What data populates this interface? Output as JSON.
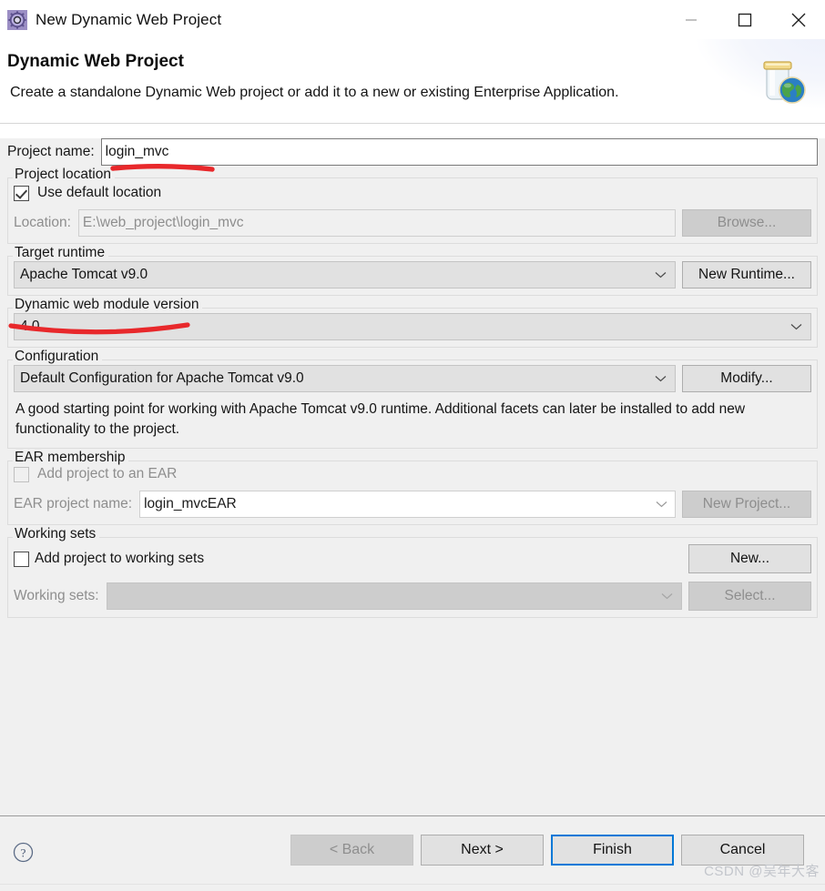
{
  "window": {
    "title": "New Dynamic Web Project",
    "icon": "gear-icon",
    "minimize": "—",
    "maximize": "□",
    "close": "✕"
  },
  "banner": {
    "title": "Dynamic Web Project",
    "subtitle": "Create a standalone Dynamic Web project or add it to a new or existing Enterprise Application.",
    "icon": "jar-globe-icon"
  },
  "form": {
    "project_name_label": "Project name:",
    "project_name_value": "login_mvc",
    "project_location": {
      "group_title": "Project location",
      "use_default_label": "Use default location",
      "use_default_checked": true,
      "location_label": "Location:",
      "location_value": "E:\\web_project\\login_mvc",
      "browse_label": "Browse...",
      "browse_enabled": false
    },
    "target_runtime": {
      "group_title": "Target runtime",
      "value": "Apache Tomcat v9.0",
      "new_runtime_label": "New Runtime..."
    },
    "module_version": {
      "group_title": "Dynamic web module version",
      "value": "4.0"
    },
    "configuration": {
      "group_title": "Configuration",
      "value": "Default Configuration for Apache Tomcat v9.0",
      "modify_label": "Modify...",
      "description": "A good starting point for working with Apache Tomcat v9.0 runtime. Additional facets can later be installed to add new functionality to the project."
    },
    "ear_membership": {
      "group_title": "EAR membership",
      "add_to_ear_label": "Add project to an EAR",
      "add_to_ear_checked": false,
      "ear_name_label": "EAR project name:",
      "ear_name_value": "login_mvcEAR",
      "new_project_label": "New Project...",
      "new_project_enabled": false
    },
    "working_sets": {
      "group_title": "Working sets",
      "add_to_working_sets_label": "Add project to working sets",
      "add_to_working_sets_checked": false,
      "new_label": "New...",
      "working_sets_label": "Working sets:",
      "working_sets_value": "",
      "select_label": "Select...",
      "select_enabled": false
    }
  },
  "footer": {
    "help_icon": "help-circle-icon",
    "back_label": "< Back",
    "back_enabled": false,
    "next_label": "Next >",
    "finish_label": "Finish",
    "finish_is_default": true,
    "cancel_label": "Cancel"
  },
  "annotations": {
    "underline_color": "#e8282b",
    "project_name_underline": "red underline under login_mvc",
    "target_runtime_underline": "red curved underline under Apache Tomcat v9.0"
  },
  "watermark": {
    "text": "CSDN @吴年大客"
  },
  "colors": {
    "dialog_bg": "#f0f0f0",
    "accent_blue": "#0078d7",
    "annotation_red": "#e8282b"
  }
}
